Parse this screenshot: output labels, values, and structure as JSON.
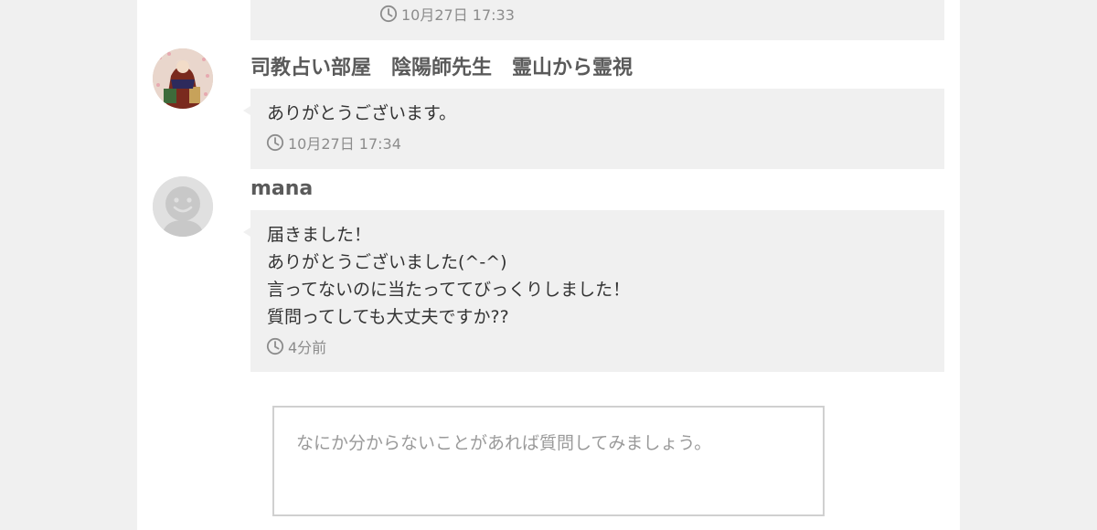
{
  "messages": [
    {
      "timestamp": "10月27日 17:33"
    },
    {
      "author": "司教占い部屋　陰陽師先生　霊山から霊視",
      "text": "ありがとうございます。",
      "timestamp": "10月27日 17:34"
    },
    {
      "author": "mana",
      "text": "届きました！\nありがとうございました(^-^)\n言ってないのに当たっててびっくりしました！\n質問ってしても大丈夫ですか??",
      "timestamp": "4分前"
    }
  ],
  "composer": {
    "placeholder": "なにか分からないことがあれば質問してみましょう。"
  },
  "icons": {
    "timestamp": "clock-icon",
    "default_avatar": "smiley-avatar-icon"
  },
  "colors": {
    "background": "#f0f0f0",
    "card": "#ffffff",
    "bubble": "#f0f0f0",
    "name": "#5a5a5a",
    "muted": "#8c8c8c"
  }
}
